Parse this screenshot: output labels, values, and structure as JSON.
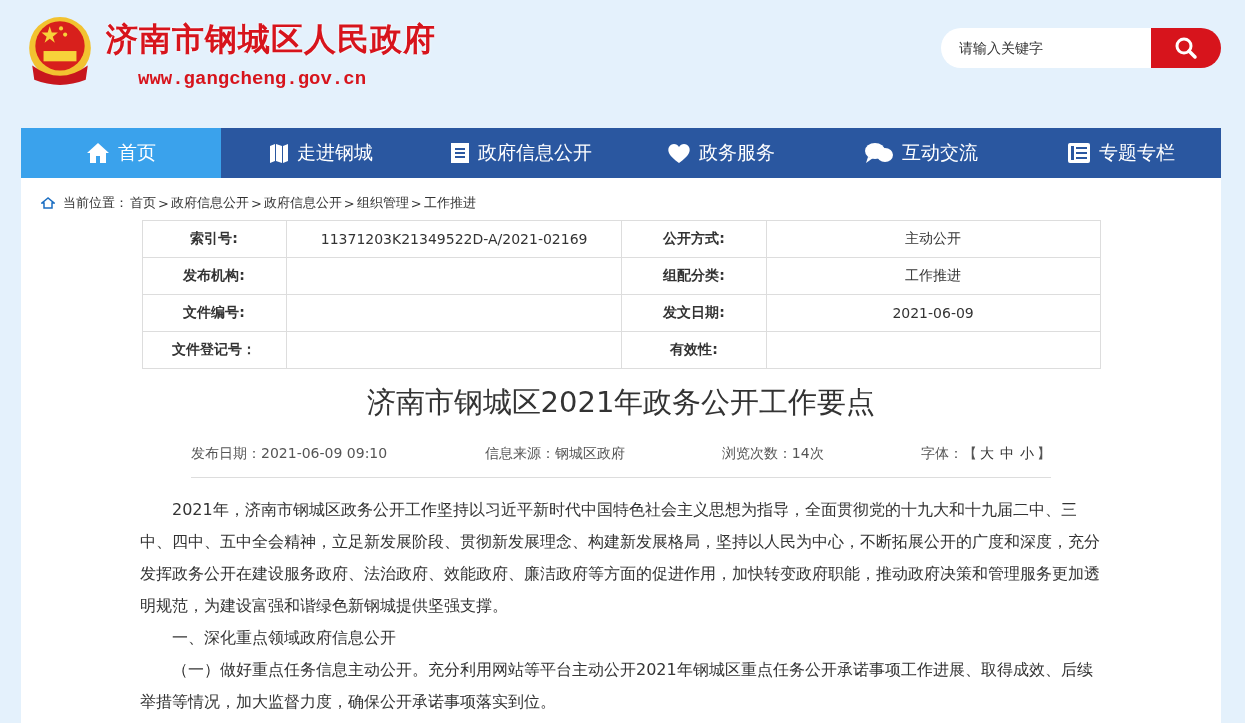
{
  "header": {
    "site_title": "济南市钢城区人民政府",
    "site_url": "www.gangcheng.gov.cn",
    "search": {
      "placeholder": "请输入关键字"
    }
  },
  "nav": [
    {
      "label": "首页",
      "kind": "home",
      "selected": true
    },
    {
      "label": "走进钢城",
      "kind": "map",
      "selected": false
    },
    {
      "label": "政府信息公开",
      "kind": "list",
      "selected": false
    },
    {
      "label": "政务服务",
      "kind": "heart",
      "selected": false
    },
    {
      "label": "互动交流",
      "kind": "chat",
      "selected": false
    },
    {
      "label": "专题专栏",
      "kind": "doc",
      "selected": false
    }
  ],
  "breadcrumb": {
    "label": "当前位置：",
    "separator": ">",
    "items": [
      "首页",
      "政府信息公开",
      "政府信息公开",
      "组织管理",
      "工作推进"
    ]
  },
  "meta_table": [
    [
      {
        "label": "索引号:",
        "value": "11371203K21349522D-A/2021-02169"
      },
      {
        "label": "公开方式:",
        "value": "主动公开"
      }
    ],
    [
      {
        "label": "发布机构:"
      },
      {
        "label": "组配分类:",
        "value": "工作推进"
      }
    ],
    [
      {
        "label": "文件编号:"
      },
      {
        "label": "发文日期:",
        "value": "2021-06-09"
      }
    ],
    [
      {
        "label": "文件登记号："
      },
      {
        "label": "有效性:"
      }
    ]
  ],
  "article": {
    "title": "济南市钢城区2021年政务公开工作要点",
    "info": [
      {
        "kind": "text",
        "text": "发布日期：2021-06-09 09:10"
      },
      {
        "kind": "text",
        "text": "信息来源：钢城区政府"
      },
      {
        "kind": "text",
        "text": "浏览次数：14次"
      },
      {
        "kind": "font",
        "label": "字体：",
        "open": "【",
        "sizes": [
          "大",
          "中",
          "小"
        ],
        "close": "】"
      }
    ],
    "paragraphs": [
      {
        "kind": "indent",
        "text": "2021年，济南市钢城区政务公开工作坚持以习近平新时代中国特色社会主义思想为指导，全面贯彻党的十九大和十九届二中、三中、四中、五中全会精神，立足新发展阶段、贯彻新发展理念、构建新发展格局，坚持以人民为中心，不断拓展公开的广度和深度，充分发挥政务公开在建设服务政府、法治政府、效能政府、廉洁政府等方面的促进作用，加快转变政府职能，推动政府决策和管理服务更加透明规范，为建设富强和谐绿色新钢城提供坚强支撑。"
      },
      {
        "kind": "indent",
        "text": "一、深化重点领域政府信息公开"
      },
      {
        "kind": "indent",
        "text": "（一）做好重点任务信息主动公开。充分利用网站等平台主动公开2021年钢城区重点任务公开承诺事项工作进展、取得成效、后续举措等情况，加大监督力度，确保公开承诺事项落实到位。"
      }
    ]
  }
}
